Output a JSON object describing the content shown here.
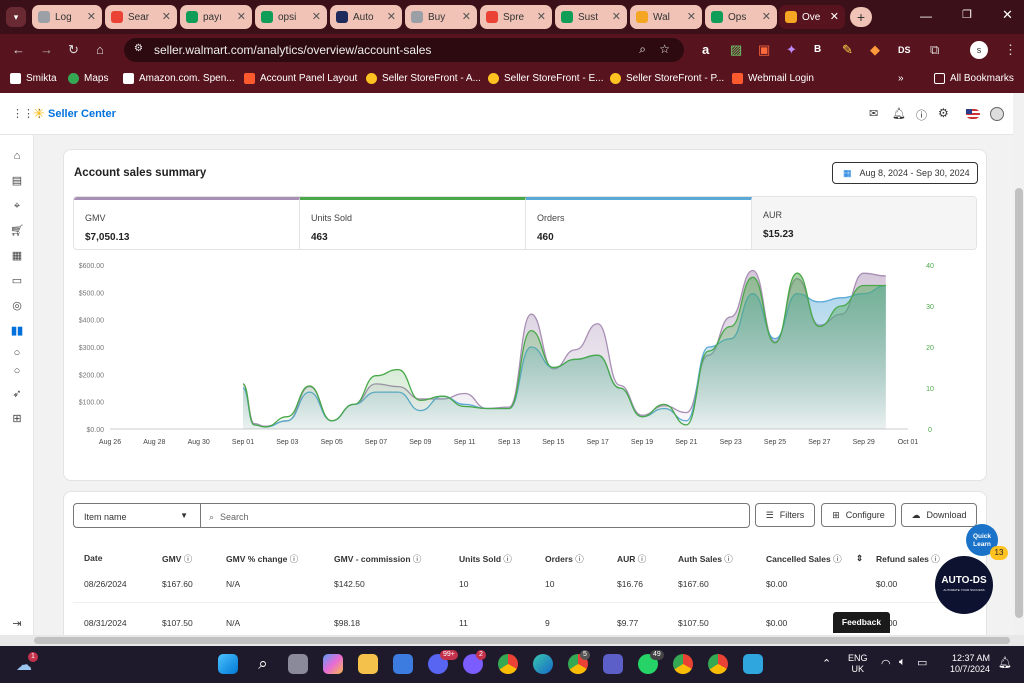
{
  "browser": {
    "tabs": [
      {
        "label": "Log",
        "fav_color": "#9aa0a6"
      },
      {
        "label": "Sear",
        "fav_color": "#ea4335"
      },
      {
        "label": "payı",
        "fav_color": "#0f9d58"
      },
      {
        "label": "opsi",
        "fav_color": "#0f9d58"
      },
      {
        "label": "Auto",
        "fav_color": "#1f2a5c"
      },
      {
        "label": "Buy",
        "fav_color": "#9aa0a6"
      },
      {
        "label": "Spre",
        "fav_color": "#ea4335"
      },
      {
        "label": "Sust",
        "fav_color": "#0f9d58"
      },
      {
        "label": "Wal",
        "fav_color": "#f5a623"
      },
      {
        "label": "Ops",
        "fav_color": "#0f9d58"
      },
      {
        "label": "Ove",
        "fav_color": "#f5a623"
      }
    ],
    "url": "seller.walmart.com/analytics/overview/account-sales",
    "bookmarks": [
      "Smikta",
      "Maps",
      "Amazon.com. Spen...",
      "Account Panel Layout",
      "Seller StoreFront - A...",
      "Seller StoreFront - E...",
      "Seller StoreFront - P...",
      "Webmail Login"
    ],
    "all_bookmarks": "All Bookmarks",
    "profile_initial": "s"
  },
  "app": {
    "brand": "Seller Center",
    "brand_color": "#0071dc",
    "spark_color": "#ffc220"
  },
  "summary": {
    "title": "Account sales summary",
    "date_range": "Aug 8, 2024 - Sep 30, 2024",
    "metrics": [
      {
        "label": "GMV",
        "value": "$7,050.13",
        "color": "#a88fb4"
      },
      {
        "label": "Units Sold",
        "value": "463",
        "color": "#4aa84a"
      },
      {
        "label": "Orders",
        "value": "460",
        "color": "#5aa9d6"
      },
      {
        "label": "AUR",
        "value": "$15.23",
        "color": "#e0e0e0"
      }
    ]
  },
  "chart_data": {
    "type": "area",
    "x": [
      "Aug 26",
      "Aug 28",
      "Aug 30",
      "Sep 01",
      "Sep 03",
      "Sep 05",
      "Sep 07",
      "Sep 09",
      "Sep 11",
      "Sep 13",
      "Sep 15",
      "Sep 17",
      "Sep 19",
      "Sep 21",
      "Sep 23",
      "Sep 25",
      "Sep 27",
      "Sep 29",
      "Oct 01"
    ],
    "y_left_ticks": [
      "$0.00",
      "$100.00",
      "$200.00",
      "$300.00",
      "$400.00",
      "$500.00",
      "$600.00"
    ],
    "y_right_ticks": [
      "0",
      "10",
      "20",
      "30",
      "40"
    ],
    "ylim_left": [
      0,
      600
    ],
    "ylim_right": [
      0,
      40
    ],
    "series": [
      {
        "name": "GMV",
        "color": "#a88fb4",
        "axis": "left",
        "points": [
          [
            6,
            165
          ],
          [
            6.5,
            20
          ],
          [
            7,
            10
          ],
          [
            8,
            30
          ],
          [
            9,
            155
          ],
          [
            10,
            30
          ],
          [
            11,
            90
          ],
          [
            12,
            165
          ],
          [
            13,
            155
          ],
          [
            14,
            110
          ],
          [
            15,
            110
          ],
          [
            16,
            130
          ],
          [
            17,
            75
          ],
          [
            18,
            80
          ],
          [
            19,
            420
          ],
          [
            20,
            220
          ],
          [
            21,
            290
          ],
          [
            22,
            385
          ],
          [
            23,
            160
          ],
          [
            24,
            50
          ],
          [
            25,
            85
          ],
          [
            26,
            60
          ],
          [
            27,
            270
          ],
          [
            28,
            410
          ],
          [
            29,
            580
          ],
          [
            30,
            320
          ],
          [
            31,
            550
          ],
          [
            32,
            380
          ],
          [
            33,
            420
          ],
          [
            34,
            570
          ],
          [
            35,
            560
          ]
        ]
      },
      {
        "name": "Units Sold",
        "color": "#4aa84a",
        "axis": "right",
        "points": [
          [
            6,
            11
          ],
          [
            6.5,
            1
          ],
          [
            7,
            0.5
          ],
          [
            8,
            3
          ],
          [
            9,
            10.5
          ],
          [
            10,
            2
          ],
          [
            11,
            6
          ],
          [
            12,
            13
          ],
          [
            13,
            14.5
          ],
          [
            14,
            7
          ],
          [
            15,
            8
          ],
          [
            16,
            5.5
          ],
          [
            17,
            5
          ],
          [
            18,
            5
          ],
          [
            19,
            24
          ],
          [
            20,
            15
          ],
          [
            21,
            17
          ],
          [
            22,
            18
          ],
          [
            23,
            10
          ],
          [
            24,
            3
          ],
          [
            25,
            6
          ],
          [
            26,
            1
          ],
          [
            27,
            19
          ],
          [
            28,
            25
          ],
          [
            29,
            37
          ],
          [
            30,
            21
          ],
          [
            31,
            38
          ],
          [
            32,
            25
          ],
          [
            33,
            30
          ],
          [
            34,
            35
          ],
          [
            35,
            35
          ]
        ]
      },
      {
        "name": "Orders",
        "color": "#5aa9d6",
        "axis": "right",
        "points": [
          [
            6,
            10
          ],
          [
            6.5,
            1
          ],
          [
            7,
            0.5
          ],
          [
            8,
            2
          ],
          [
            9,
            9
          ],
          [
            10,
            2
          ],
          [
            11,
            6
          ],
          [
            12,
            9
          ],
          [
            13,
            9
          ],
          [
            14,
            4.5
          ],
          [
            15,
            8
          ],
          [
            16,
            6
          ],
          [
            17,
            5
          ],
          [
            18,
            5
          ],
          [
            19,
            20
          ],
          [
            20,
            15
          ],
          [
            21,
            17
          ],
          [
            22,
            18
          ],
          [
            23,
            10
          ],
          [
            24,
            3
          ],
          [
            25,
            5
          ],
          [
            26,
            2
          ],
          [
            27,
            20
          ],
          [
            28,
            22
          ],
          [
            29,
            33
          ],
          [
            30,
            22
          ],
          [
            31,
            33
          ],
          [
            32,
            31
          ],
          [
            33,
            32
          ],
          [
            34,
            33
          ],
          [
            35,
            35
          ]
        ]
      }
    ]
  },
  "table_controls": {
    "item_select": "Item name",
    "search_placeholder": "Search",
    "filters": "Filters",
    "configure": "Configure",
    "download": "Download"
  },
  "table": {
    "columns": [
      "Date",
      "GMV",
      "GMV % change",
      "GMV - commission",
      "Units Sold",
      "Orders",
      "AUR",
      "Auth Sales",
      "Cancelled Sales",
      "Refund sales"
    ],
    "rows": [
      [
        "08/26/2024",
        "$167.60",
        "N/A",
        "$142.50",
        "10",
        "10",
        "$16.76",
        "$167.60",
        "$0.00",
        "$0.00"
      ],
      [
        "08/31/2024",
        "$107.50",
        "N/A",
        "$98.18",
        "11",
        "9",
        "$9.77",
        "$107.50",
        "$0.00",
        "$0.00"
      ]
    ]
  },
  "widgets": {
    "quick_learn": "Quick Learn",
    "quick_learn_count": "13",
    "autods_logo": "AUTO-DS",
    "autods_tagline": "AUTOMATE YOUR SUCCESS",
    "feedback": "Feedback"
  },
  "taskbar": {
    "weather_badge": "1",
    "lang_top": "ENG",
    "lang_bottom": "UK",
    "time": "12:37 AM",
    "date": "10/7/2024",
    "badges": [
      "99+",
      "2",
      "5",
      "49"
    ]
  }
}
